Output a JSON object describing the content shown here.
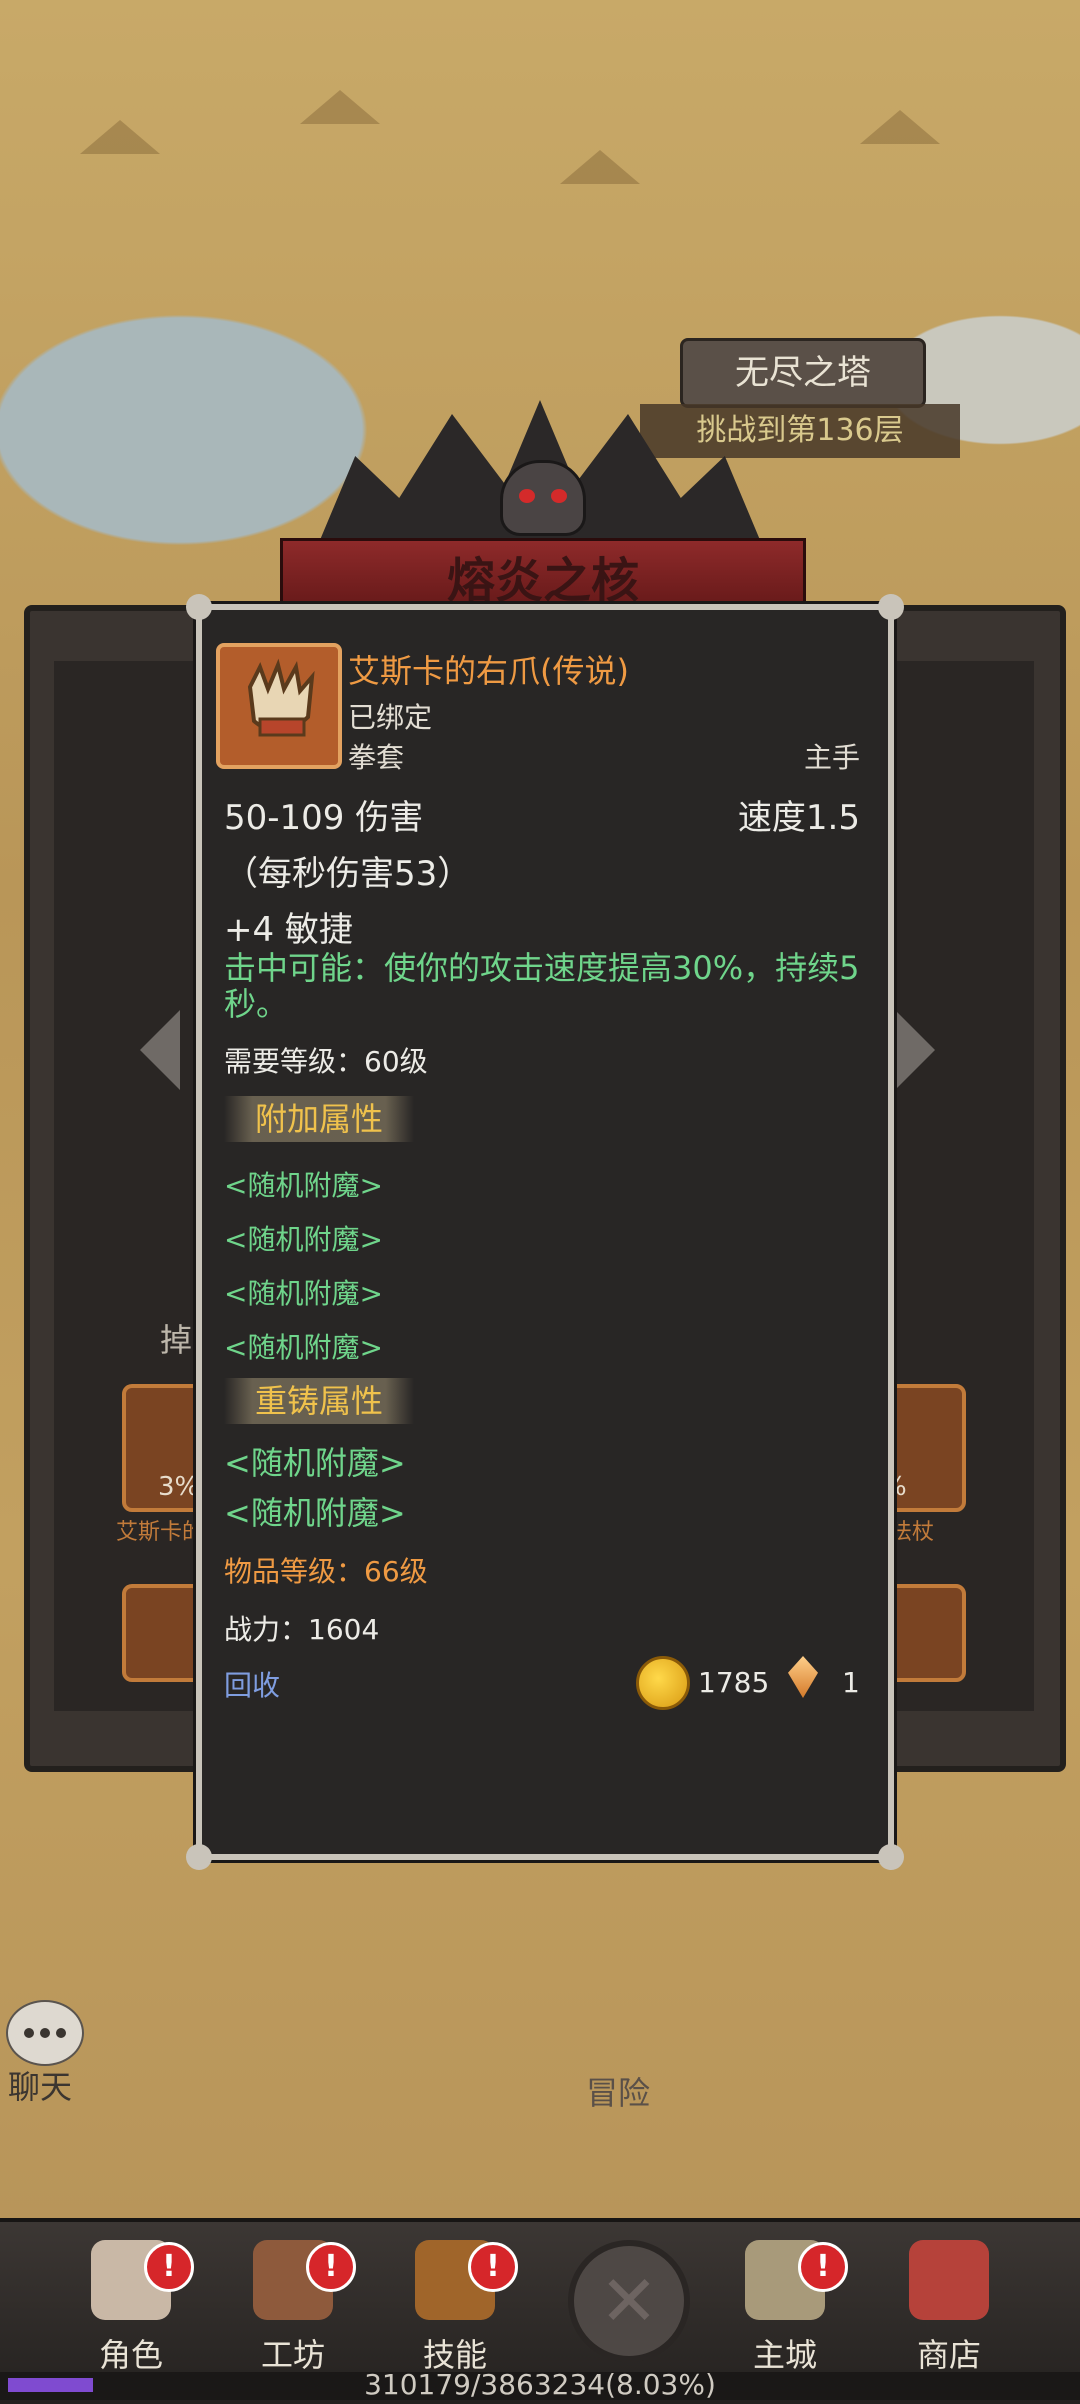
{
  "map": {
    "tower_name": "无尽之塔",
    "tower_progress": "挑战到第136层",
    "dungeon_title": "熔炎之核",
    "drop_label": "掉",
    "slots": [
      {
        "pct": "3%",
        "name": "艾斯卡的"
      },
      {
        "pct": "%",
        "name": "的法杖"
      }
    ]
  },
  "tooltip": {
    "name": "艾斯卡的右爪(传说)",
    "bound": "已绑定",
    "type": "拳套",
    "slot": "主手",
    "damage": "50-109 伤害",
    "speed": "速度1.5",
    "dps": "（每秒伤害53）",
    "agility": "+4 敏捷",
    "proc": "击中可能：使你的攻击速度提高30%，持续5秒。",
    "required_level": "需要等级：60级",
    "extra_header": "附加属性",
    "enchants": [
      "<随机附魔>",
      "<随机附魔>",
      "<随机附魔>",
      "<随机附魔>"
    ],
    "reforge_header": "重铸属性",
    "reforges": [
      "<随机附魔>",
      "<随机附魔>"
    ],
    "item_level": "物品等级：66级",
    "power": "战力：1604",
    "recycle": "回收",
    "gold": "1785",
    "gem": "1",
    "rarity_color": "#ef9a43",
    "proc_color": "#6fd58b"
  },
  "chat_label": "聊天",
  "adventure_label": "冒险",
  "nav": [
    {
      "label": "角色",
      "badge": "!",
      "icon": "character-icon"
    },
    {
      "label": "工坊",
      "badge": "!",
      "icon": "workshop-icon"
    },
    {
      "label": "技能",
      "badge": "!",
      "icon": "skills-icon"
    },
    {
      "label": "主城",
      "badge": "!",
      "icon": "castle-icon"
    },
    {
      "label": "商店",
      "badge": "",
      "icon": "shop-icon"
    }
  ],
  "xp": {
    "text": "310179/3863234(8.03%)",
    "fraction": 0.0803
  }
}
